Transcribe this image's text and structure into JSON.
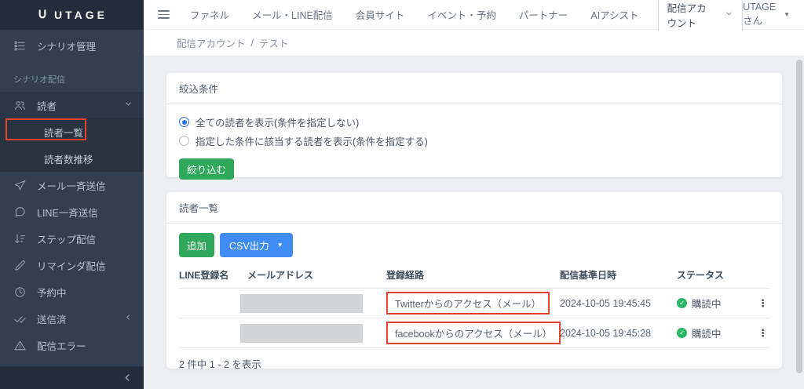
{
  "colors": {
    "sidebar_bg": "#323e52",
    "sidebar_dark": "#222c3d",
    "annotation_red": "#e2432e",
    "button_green": "#2fa85c",
    "button_blue": "#3e8cf4",
    "status_green": "#29b765",
    "radio_blue": "#2e6fe8"
  },
  "sidebar": {
    "logo": "UTAGE",
    "top_item": {
      "label": "シナリオ管理",
      "icon": "scenario-list-icon"
    },
    "section_label": "シナリオ配信",
    "group": {
      "label": "読者",
      "icon": "users-icon",
      "state": "expanded"
    },
    "submenu": [
      {
        "label": "読者一覧",
        "active": true,
        "annotated": true
      },
      {
        "label": "読者数推移"
      }
    ],
    "items": [
      {
        "label": "メール一斉送信",
        "icon": "send-icon"
      },
      {
        "label": "LINE一斉送信",
        "icon": "chat-icon"
      },
      {
        "label": "ステップ配信",
        "icon": "steps-icon"
      },
      {
        "label": "リマインダ配信",
        "icon": "pencil-icon"
      },
      {
        "label": "予約中",
        "icon": "clock-icon"
      },
      {
        "label": "送信済",
        "icon": "check-icon",
        "has_submenu": true
      },
      {
        "label": "配信エラー",
        "icon": "warning-icon"
      }
    ]
  },
  "topbar": {
    "nav": [
      "ファネル",
      "メール・LINE配信",
      "会員サイト",
      "イベント・予約",
      "パートナー",
      "AIアシスト"
    ],
    "account_dropdown": "配信アカウント",
    "user": "UTAGE さん"
  },
  "breadcrumb": {
    "parent": "配信アカウント",
    "separator": "/",
    "current": "テスト"
  },
  "filter": {
    "title": "絞込条件",
    "radio_all": "全ての読者を表示(条件を指定しない)",
    "radio_all_checked": true,
    "radio_cond": "指定した条件に該当する読者を表示(条件を指定する)",
    "submit_label": "絞り込む"
  },
  "readers": {
    "title": "読者一覧",
    "add_label": "追加",
    "csv_label": "CSV出力",
    "columns": [
      "LINE登録名",
      "メールアドレス",
      "登録経路",
      "配信基準日時",
      "ステータス"
    ],
    "rows": [
      {
        "line_name": "",
        "email_masked": true,
        "route": "Twitterからのアクセス（メール）",
        "route_annotated": true,
        "base_datetime": "2024-10-05 19:45:45",
        "status": "購読中"
      },
      {
        "line_name": "",
        "email_masked": true,
        "route": "facebookからのアクセス（メール）",
        "route_annotated": true,
        "base_datetime": "2024-10-05 19:45:28",
        "status": "購読中"
      }
    ],
    "summary": "2 件中 1 - 2 を表示"
  }
}
